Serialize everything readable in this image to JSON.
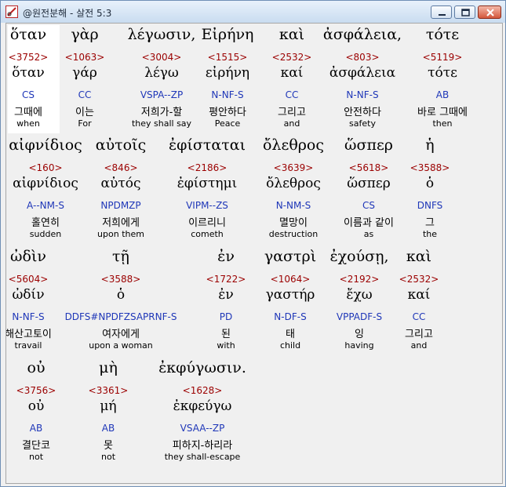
{
  "window": {
    "title": "@원전분해 - 살전 5:3"
  },
  "rows": [
    {
      "words": [
        {
          "greek": "ὅταν",
          "num": "<3752>",
          "lemma": "ὅταν",
          "code": "CS",
          "korean": "그때에",
          "english": "when",
          "highlight": true
        },
        {
          "greek": "γὰρ",
          "num": "<1063>",
          "lemma": "γάρ",
          "code": "CC",
          "korean": "이는",
          "english": "For"
        },
        {
          "greek": "λέγωσιν,",
          "num": "<3004>",
          "lemma": "λέγω",
          "code": "VSPA--ZP",
          "korean": "저희가-할",
          "english": "they shall say"
        },
        {
          "greek": "Εἰρήνη",
          "num": "<1515>",
          "lemma": "εἰρήνη",
          "code": "N-NF-S",
          "korean": "평안하다",
          "english": "Peace"
        },
        {
          "greek": "καὶ",
          "num": "<2532>",
          "lemma": "καί",
          "code": "CC",
          "korean": "그리고",
          "english": "and"
        },
        {
          "greek": "ἀσφάλεια,",
          "num": "<803>",
          "lemma": "ἀσφάλεια",
          "code": "N-NF-S",
          "korean": "안전하다",
          "english": "safety"
        },
        {
          "greek": "τότε",
          "num": "<5119>",
          "lemma": "τότε",
          "code": "AB",
          "korean": "바로 그때에",
          "english": "then"
        }
      ]
    },
    {
      "words": [
        {
          "greek": "αἰφνίδιος",
          "num": "<160>",
          "lemma": "αἰφνίδιος",
          "code": "A--NM-S",
          "korean": "홀연히",
          "english": "sudden"
        },
        {
          "greek": "αὐτοῖς",
          "num": "<846>",
          "lemma": "αὐτός",
          "code": "NPDMZP",
          "korean": "저희에게",
          "english": "upon them"
        },
        {
          "greek": "ἐφίσταται",
          "num": "<2186>",
          "lemma": "ἐφίστημι",
          "code": "VIPM--ZS",
          "korean": "이르리니",
          "english": "cometh"
        },
        {
          "greek": "ὄλεθρος",
          "num": "<3639>",
          "lemma": "ὄλεθρος",
          "code": "N-NM-S",
          "korean": "멸망이",
          "english": "destruction"
        },
        {
          "greek": "ὥσπερ",
          "num": "<5618>",
          "lemma": "ὥσπερ",
          "code": "CS",
          "korean": "이름과 같이",
          "english": "as"
        },
        {
          "greek": "ἡ",
          "num": "<3588>",
          "lemma": "ὁ",
          "code": "DNFS",
          "korean": "그",
          "english": "the"
        }
      ]
    },
    {
      "words": [
        {
          "greek": "ὠδὶν",
          "num": "<5604>",
          "lemma": "ὠδίν",
          "code": "N-NF-S",
          "korean": "해산고토이",
          "english": "travail"
        },
        {
          "greek": "τῇ",
          "num": "<3588>",
          "lemma": "ὁ",
          "code": "DDFS#NPDFZSAPRNF-S",
          "korean": "여자에게",
          "english": "upon a woman"
        },
        {
          "greek": "ἐν",
          "num": "<1722>",
          "lemma": "ἐν",
          "code": "PD",
          "korean": "된",
          "english": "with"
        },
        {
          "greek": "γαστρὶ",
          "num": "<1064>",
          "lemma": "γαστήρ",
          "code": "N-DF-S",
          "korean": "태",
          "english": "child"
        },
        {
          "greek": "ἐχούσῃ,",
          "num": "<2192>",
          "lemma": "ἔχω",
          "code": "VPPADF-S",
          "korean": "잉",
          "english": "having"
        },
        {
          "greek": "καὶ",
          "num": "<2532>",
          "lemma": "καί",
          "code": "CC",
          "korean": "그리고",
          "english": "and"
        }
      ]
    },
    {
      "words": [
        {
          "greek": "οὐ",
          "num": "<3756>",
          "lemma": "οὐ",
          "code": "AB",
          "korean": "결단코",
          "english": "not"
        },
        {
          "greek": "μὴ",
          "num": "<3361>",
          "lemma": "μή",
          "code": "AB",
          "korean": "못",
          "english": "not"
        },
        {
          "greek": "ἐκφύγωσιν.",
          "num": "<1628>",
          "lemma": "ἐκφεύγω",
          "code": "VSAA--ZP",
          "korean": "피하지-하리라",
          "english": "they shall-escape"
        }
      ]
    }
  ]
}
